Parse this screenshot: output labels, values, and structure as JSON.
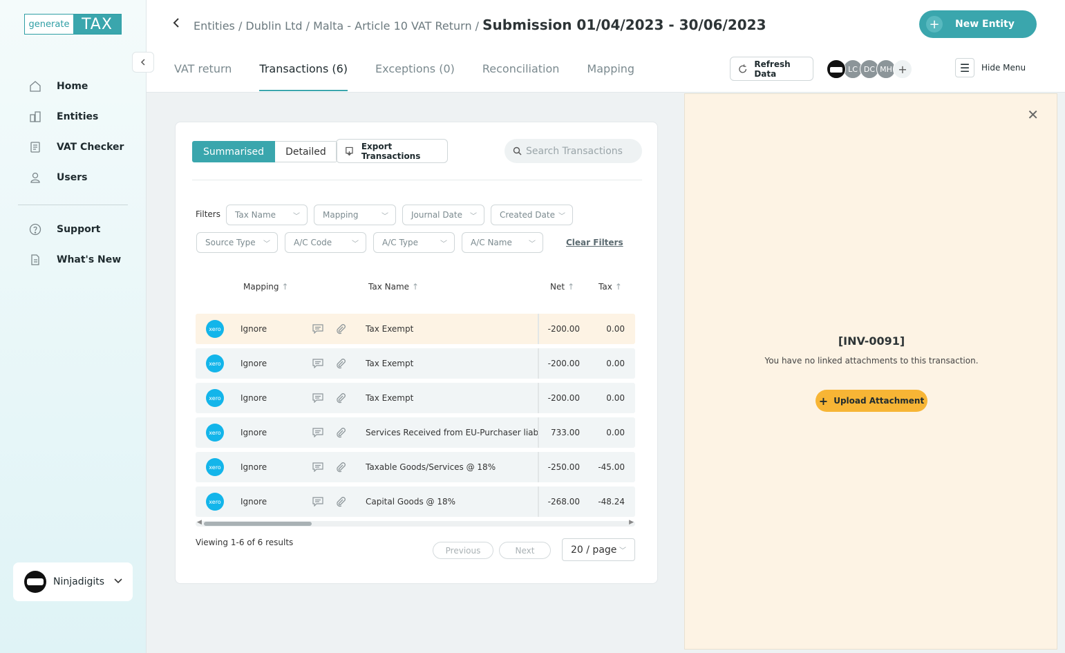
{
  "app": {
    "logo_left": "generate",
    "logo_right": "TAX"
  },
  "sidebar": {
    "items": [
      {
        "label": "Home",
        "icon": "home-icon"
      },
      {
        "label": "Entities",
        "icon": "building-icon"
      },
      {
        "label": "VAT Checker",
        "icon": "document-icon"
      },
      {
        "label": "Users",
        "icon": "user-icon"
      },
      {
        "label": "Support",
        "icon": "help-icon"
      },
      {
        "label": "What's New",
        "icon": "news-icon"
      }
    ],
    "org_name": "Ninjadigits"
  },
  "header": {
    "breadcrumb": "Entities / Dublin Ltd / Malta - Article 10 VAT Return /",
    "current": "Submission 01/04/2023 - 30/06/2023",
    "new_entity": "New Entity",
    "tabs": [
      "VAT return",
      "Transactions (6)",
      "Exceptions (0)",
      "Reconciliation",
      "Mapping"
    ],
    "refresh": "Refresh Data",
    "avatars": [
      "LC",
      "DC",
      "MH"
    ],
    "hide_menu": "Hide Menu"
  },
  "toolbar": {
    "summarised": "Summarised",
    "detailed": "Detailed",
    "export": "Export Transactions",
    "search_placeholder": "Search Transactions"
  },
  "filters": {
    "label": "Filters",
    "items": [
      "Tax Name",
      "Mapping",
      "Journal Date",
      "Created Date",
      "Source Type",
      "A/C Code",
      "A/C Type",
      "A/C Name"
    ],
    "clear": "Clear Filters"
  },
  "table": {
    "headers": {
      "mapping": "Mapping",
      "tax_name": "Tax Name",
      "net": "Net",
      "tax": "Tax"
    },
    "rows": [
      {
        "source": "xero",
        "mapping": "Ignore",
        "tax_name": "Tax Exempt",
        "net": "-200.00",
        "tax": "0.00"
      },
      {
        "source": "xero",
        "mapping": "Ignore",
        "tax_name": "Tax Exempt",
        "net": "-200.00",
        "tax": "0.00"
      },
      {
        "source": "xero",
        "mapping": "Ignore",
        "tax_name": "Tax Exempt",
        "net": "-200.00",
        "tax": "0.00"
      },
      {
        "source": "xero",
        "mapping": "Ignore",
        "tax_name": "Services Received from EU-Purchaser liable",
        "net": "733.00",
        "tax": "0.00"
      },
      {
        "source": "xero",
        "mapping": "Ignore",
        "tax_name": "Taxable Goods/Services @ 18%",
        "net": "-250.00",
        "tax": "-45.00"
      },
      {
        "source": "xero",
        "mapping": "Ignore",
        "tax_name": "Capital Goods @ 18%",
        "net": "-268.00",
        "tax": "-48.24"
      }
    ]
  },
  "pagination": {
    "viewing": "Viewing 1-6 of 6 results",
    "previous": "Previous",
    "next": "Next",
    "per_page": "20 / page"
  },
  "panel": {
    "invoice": "[INV-0091]",
    "message": "You have no linked attachments to this transaction.",
    "upload": "Upload Attachment"
  },
  "colors": {
    "accent": "#3aa6ad",
    "panel_bg": "#fdf3e4",
    "upload": "#f7b535",
    "negative": "#c0392b",
    "xero": "#13b5ea"
  }
}
